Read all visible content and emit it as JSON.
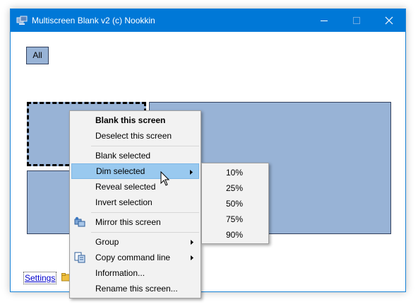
{
  "window": {
    "title": "Multiscreen Blank v2 (c) Nookkin",
    "accent_color": "#0078d7",
    "icon": "app-icon",
    "controls": [
      "minimize-icon",
      "maximize-icon",
      "close-icon"
    ]
  },
  "toolbar": {
    "all_label": "All"
  },
  "screens": [
    {
      "id": 1,
      "selected": true
    },
    {
      "id": 2,
      "selected": false
    },
    {
      "id": 3,
      "selected": false
    }
  ],
  "screen_color": "#98b3d6",
  "footer": {
    "settings_label": "Settings",
    "settings_icon": "settings-icon"
  },
  "context_menu": {
    "items": [
      {
        "label": "Blank this screen",
        "bold": true
      },
      {
        "label": "Deselect this screen"
      },
      {
        "label": "Blank selected"
      },
      {
        "label": "Dim selected",
        "highlighted": true,
        "submenu": true
      },
      {
        "label": "Reveal selected"
      },
      {
        "label": "Invert selection"
      },
      {
        "label": "Mirror this screen",
        "icon": "mirror-icon"
      },
      {
        "label": "Group",
        "submenu": true
      },
      {
        "label": "Copy command line",
        "icon": "copy-icon",
        "submenu": true
      },
      {
        "label": "Information..."
      },
      {
        "label": "Rename this screen..."
      }
    ]
  },
  "dim_submenu": {
    "items": [
      {
        "label": "10%"
      },
      {
        "label": "25%"
      },
      {
        "label": "50%"
      },
      {
        "label": "75%"
      },
      {
        "label": "90%"
      }
    ]
  }
}
